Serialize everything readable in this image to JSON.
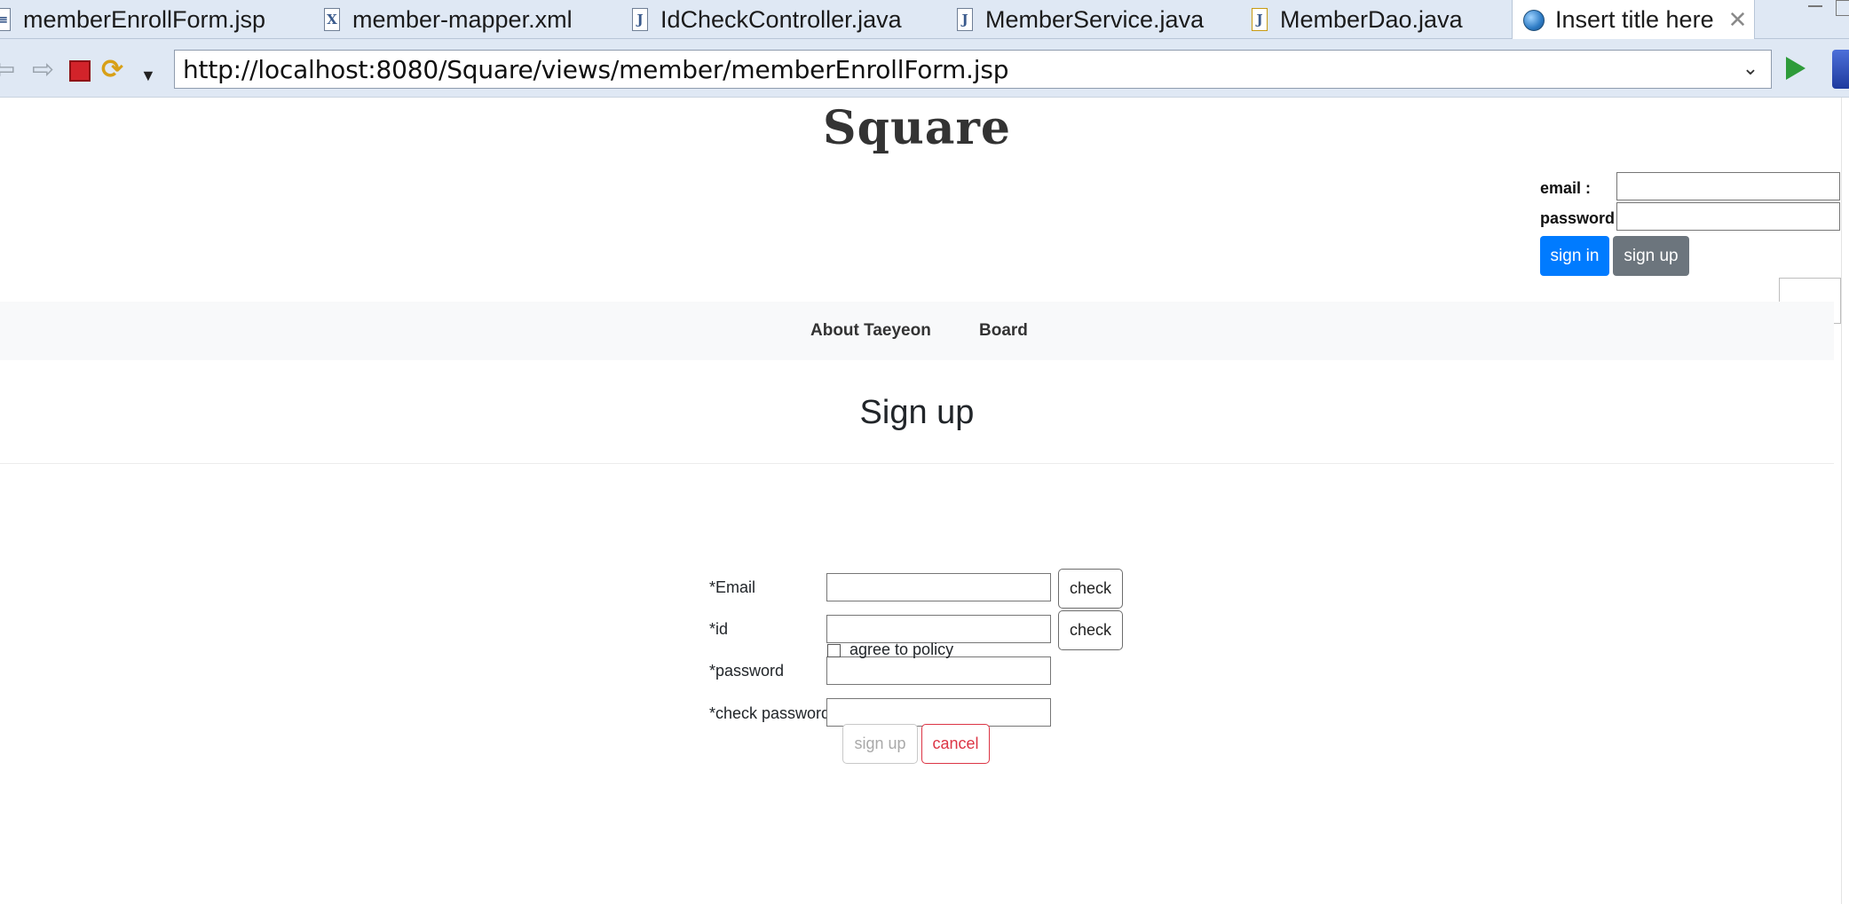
{
  "editor_tabs": [
    {
      "label": "memberEnrollForm.jsp",
      "icon": "jsp-file-icon"
    },
    {
      "label": "member-mapper.xml",
      "icon": "xml-file-icon"
    },
    {
      "label": "IdCheckController.java",
      "icon": "java-file-icon"
    },
    {
      "label": "MemberService.java",
      "icon": "java-file-icon"
    },
    {
      "label": "MemberDao.java",
      "icon": "java-file-warning-icon"
    },
    {
      "label": "Insert title here",
      "icon": "globe-icon",
      "active": true
    }
  ],
  "toolbar": {
    "url": "http://localhost:8080/Square/views/member/memberEnrollForm.jsp",
    "back_icon": "back-arrow-icon",
    "forward_icon": "forward-arrow-icon",
    "stop_icon": "stop-icon",
    "refresh_icon": "refresh-icon",
    "go_icon": "go-play-icon"
  },
  "header": {
    "logo": "Square",
    "login": {
      "email_label": "email :",
      "password_label": "password :",
      "signin_label": "sign in",
      "signup_label": "sign up"
    }
  },
  "nav": {
    "items": [
      "About Taeyeon",
      "Board"
    ]
  },
  "form": {
    "title": "Sign up",
    "email_label": "*Email",
    "id_label": "*id",
    "password_label": "*password",
    "check_password_label": "*check password",
    "check_label": "check",
    "agree_label": "agree to policy",
    "submit_label": "sign up",
    "cancel_label": "cancel"
  },
  "colors": {
    "primary": "#007bff",
    "secondary": "#6c757d",
    "danger": "#dc3545",
    "navbar_bg": "#f8f9fa",
    "ide_chrome": "#dfe8f4"
  }
}
